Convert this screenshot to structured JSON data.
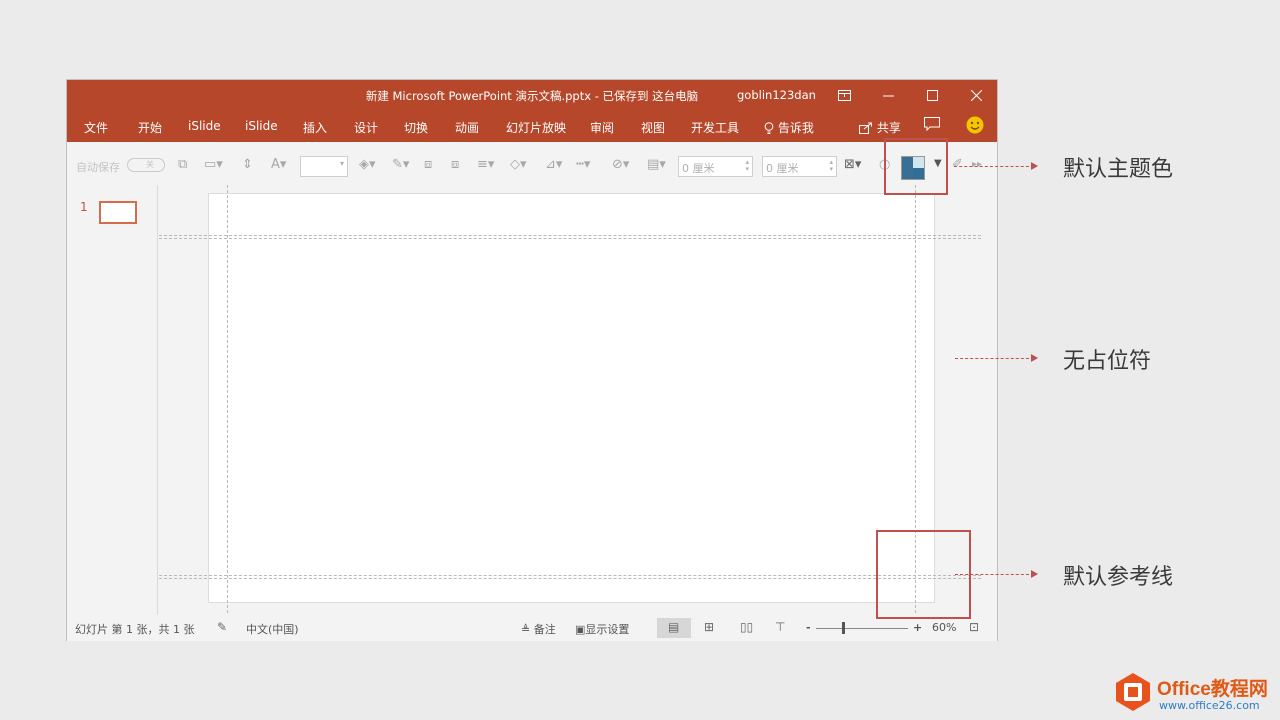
{
  "window": {
    "title": "新建 Microsoft PowerPoint 演示文稿.pptx - 已保存到 这台电脑",
    "user": "goblin123dan",
    "accent": "#b7472a"
  },
  "tabs": {
    "file": "文件",
    "home": "开始",
    "islide1": "iSlide",
    "islide2": "iSlide",
    "insert": "插入",
    "design": "设计",
    "transitions": "切换",
    "animations": "动画",
    "slideshow": "幻灯片放映",
    "review": "审阅",
    "view": "视图",
    "developer": "开发工具",
    "tellme": "告诉我",
    "share": "共享"
  },
  "toolbar": {
    "autosave_label": "自动保存",
    "autosave_state": "关",
    "width_field": "0 厘米",
    "height_field": "0 厘米"
  },
  "thumbnails": {
    "slide_number": "1"
  },
  "statusbar": {
    "slide_info": "幻灯片 第 1 张，共 1 张",
    "language": "中文(中国)",
    "notes": "备注",
    "display_settings": "显示设置",
    "zoom_minus": "-",
    "zoom_plus": "+",
    "zoom": "60%"
  },
  "callouts": {
    "theme_color": "默认主题色",
    "no_placeholder": "无占位符",
    "guides": "默认参考线",
    "color": "#c0504d"
  },
  "watermark": {
    "title": "Office教程网",
    "url": "www.office26.com"
  }
}
